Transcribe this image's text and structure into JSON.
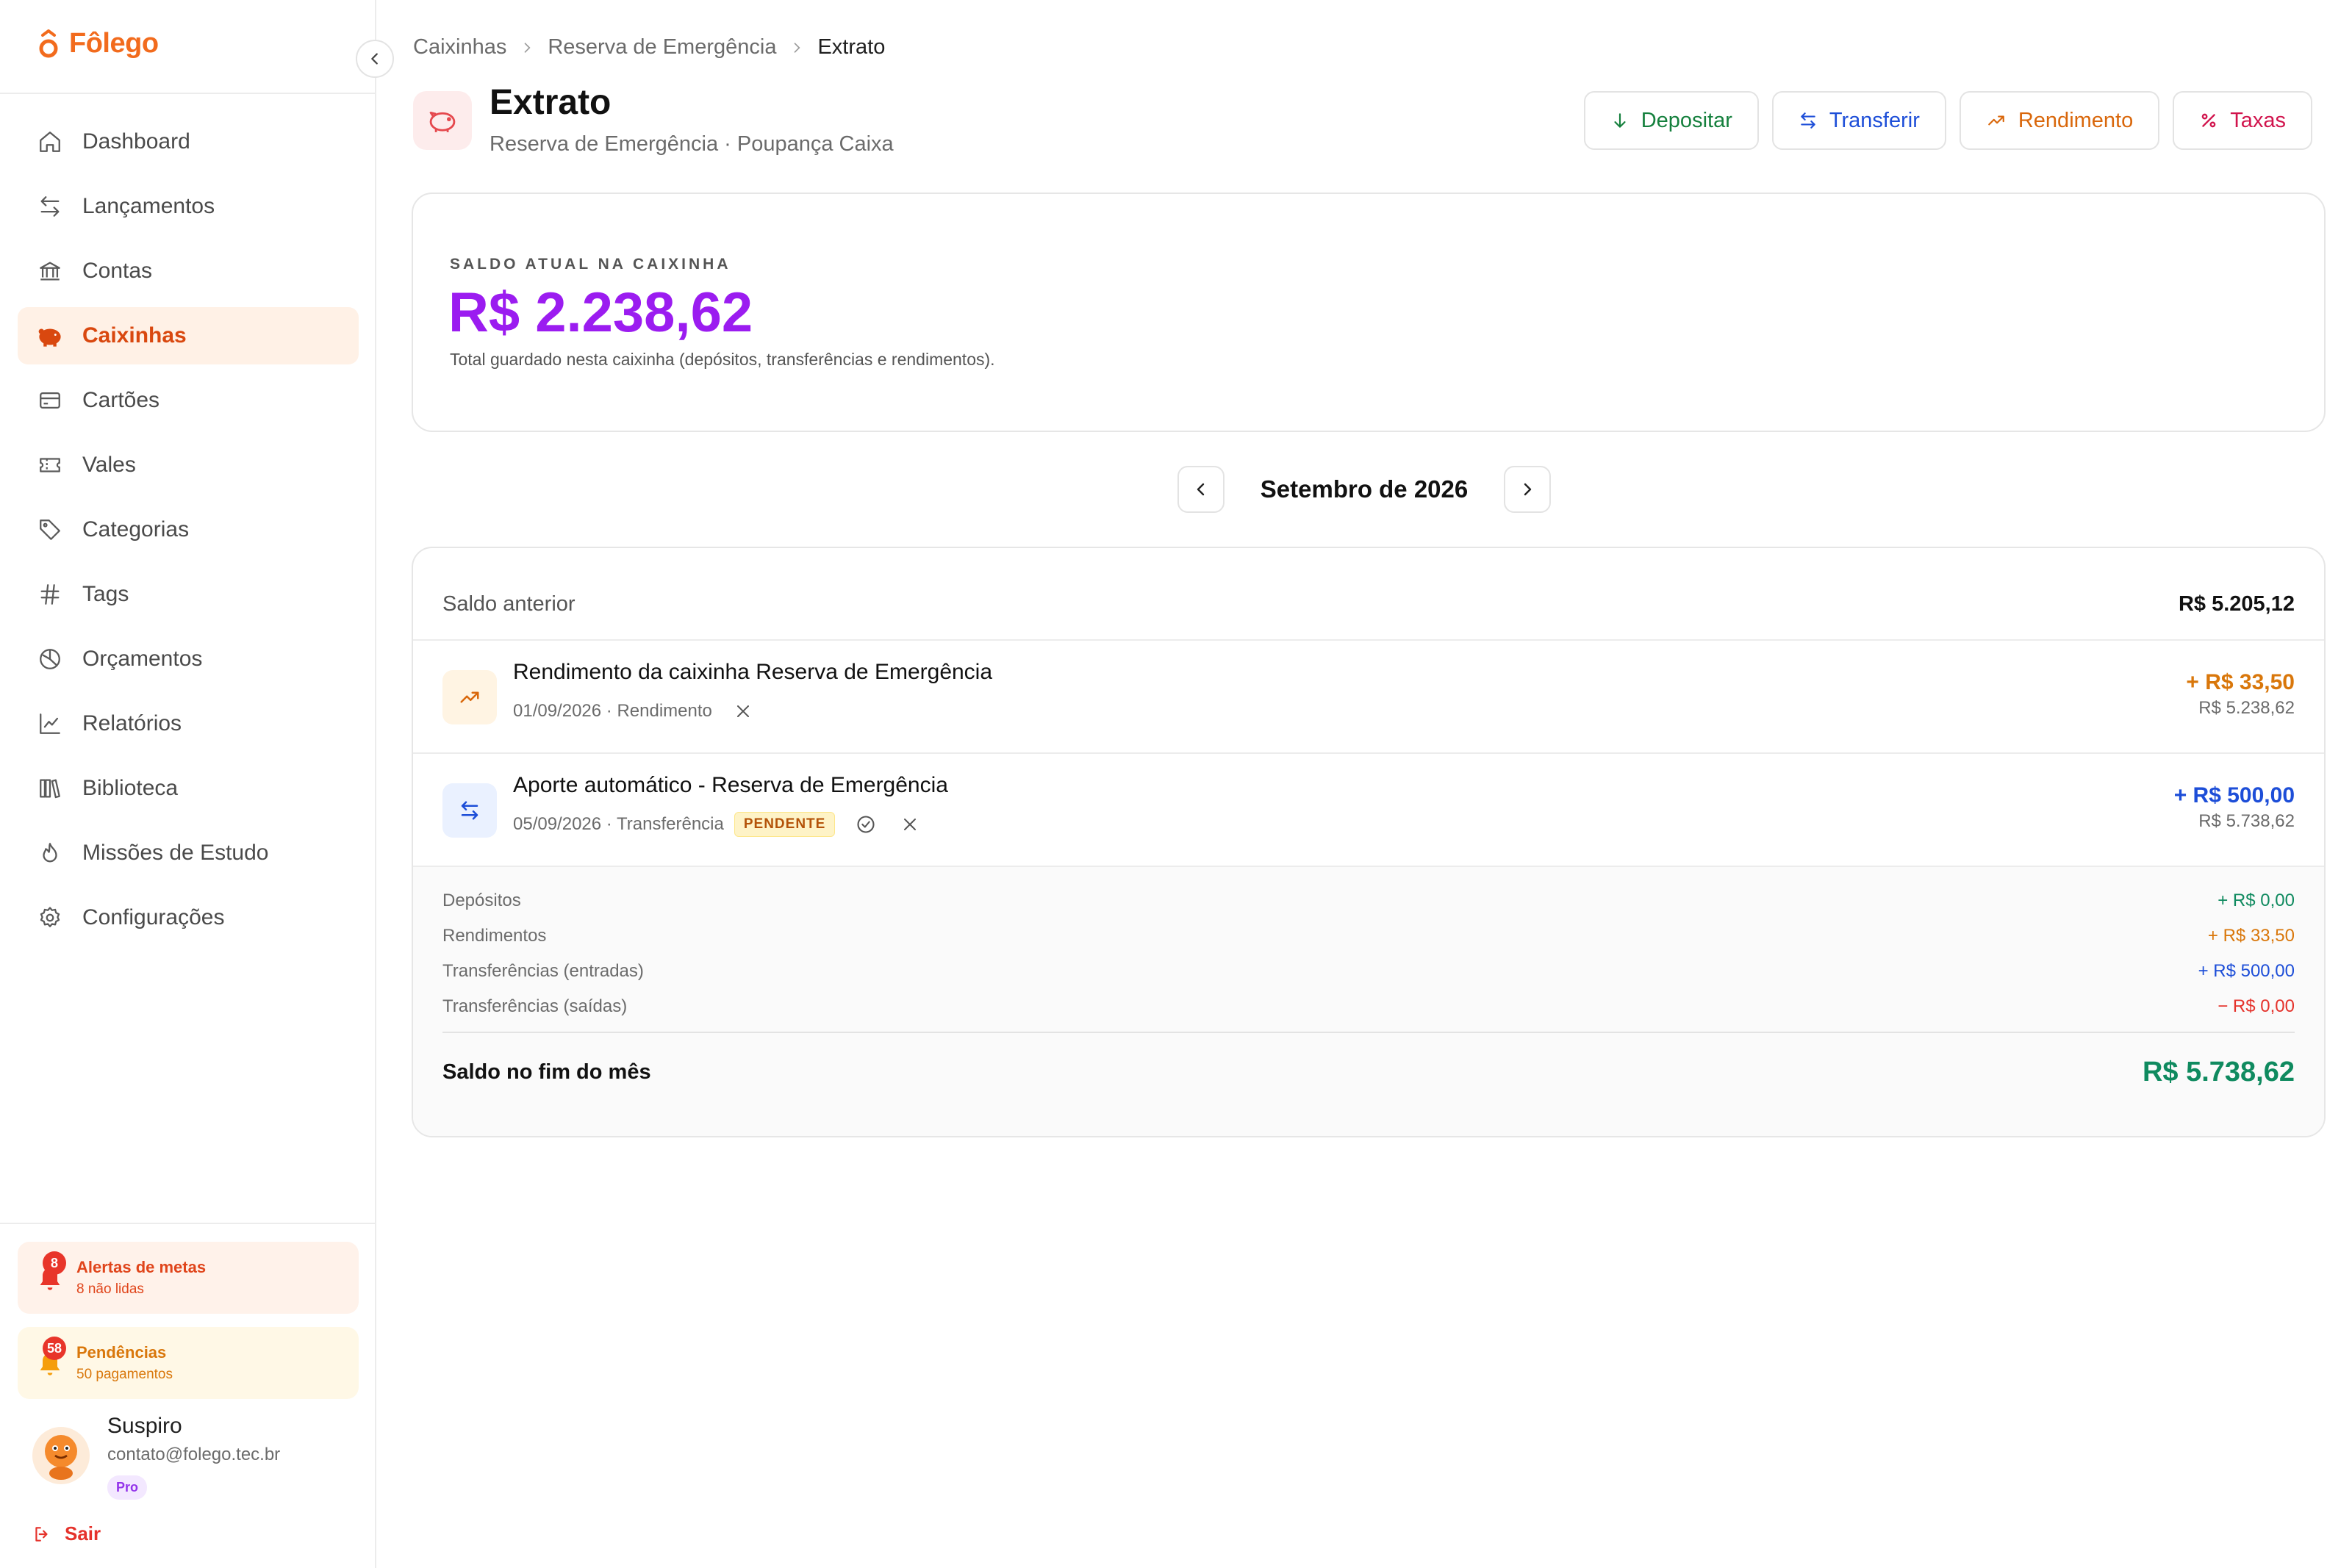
{
  "app": {
    "name": "Fôlego",
    "brand_color": "#f26b1d"
  },
  "sidebar": {
    "items": [
      {
        "label": "Dashboard",
        "icon": "home-icon"
      },
      {
        "label": "Lançamentos",
        "icon": "arrows-exchange-icon"
      },
      {
        "label": "Contas",
        "icon": "bank-icon"
      },
      {
        "label": "Caixinhas",
        "icon": "piggy-bank-icon",
        "active": true
      },
      {
        "label": "Cartões",
        "icon": "credit-card-icon"
      },
      {
        "label": "Vales",
        "icon": "ticket-icon"
      },
      {
        "label": "Categorias",
        "icon": "tag-icon"
      },
      {
        "label": "Tags",
        "icon": "hash-icon"
      },
      {
        "label": "Orçamentos",
        "icon": "pie-chart-icon"
      },
      {
        "label": "Relatórios",
        "icon": "line-chart-icon"
      },
      {
        "label": "Biblioteca",
        "icon": "books-icon"
      },
      {
        "label": "Missões de Estudo",
        "icon": "flame-icon"
      },
      {
        "label": "Configurações",
        "icon": "gear-icon"
      }
    ],
    "alerts": {
      "goals": {
        "title": "Alertas de metas",
        "subtitle": "8 não lidas",
        "count": "8"
      },
      "pending": {
        "title": "Pendências",
        "subtitle": "50 pagamentos",
        "count": "58"
      }
    },
    "user": {
      "name": "Suspiro",
      "email": "contato@folego.tec.br",
      "plan": "Pro"
    },
    "logout_label": "Sair"
  },
  "breadcrumb": {
    "items": [
      "Caixinhas",
      "Reserva de Emergência"
    ],
    "current": "Extrato"
  },
  "header": {
    "title": "Extrato",
    "subtitle": "Reserva de Emergência · Poupança Caixa",
    "actions": {
      "deposit": "Depositar",
      "transfer": "Transferir",
      "yield": "Rendimento",
      "fees": "Taxas"
    }
  },
  "balance": {
    "label": "SALDO ATUAL NA CAIXINHA",
    "value": "R$ 2.238,62",
    "description": "Total guardado nesta caixinha (depósitos, transferências e rendimentos).",
    "color": "#9b1cf0"
  },
  "month": {
    "label": "Setembro de 2026"
  },
  "statement": {
    "previous": {
      "label": "Saldo anterior",
      "value": "R$ 5.205,12"
    },
    "transactions": [
      {
        "title": "Rendimento da caixinha Reserva de Emergência",
        "meta": "01/09/2026 · Rendimento",
        "amount": "+ R$ 33,50",
        "running_balance": "R$ 5.238,62",
        "icon": "trending-up-icon"
      },
      {
        "title": "Aporte automático - Reserva de Emergência",
        "meta": "05/09/2026 · Transferência",
        "status": "PENDENTE",
        "amount": "+ R$ 500,00",
        "running_balance": "R$ 5.738,62",
        "icon": "arrows-exchange-icon"
      }
    ],
    "summary": {
      "deposits": {
        "label": "Depósitos",
        "value": "+ R$ 0,00"
      },
      "yields": {
        "label": "Rendimentos",
        "value": "+ R$ 33,50"
      },
      "transfers_in": {
        "label": "Transferências (entradas)",
        "value": "+ R$ 500,00"
      },
      "transfers_out": {
        "label": "Transferências (saídas)",
        "value": "− R$ 0,00"
      },
      "end": {
        "label": "Saldo no fim do mês",
        "value": "R$ 5.738,62"
      }
    }
  }
}
